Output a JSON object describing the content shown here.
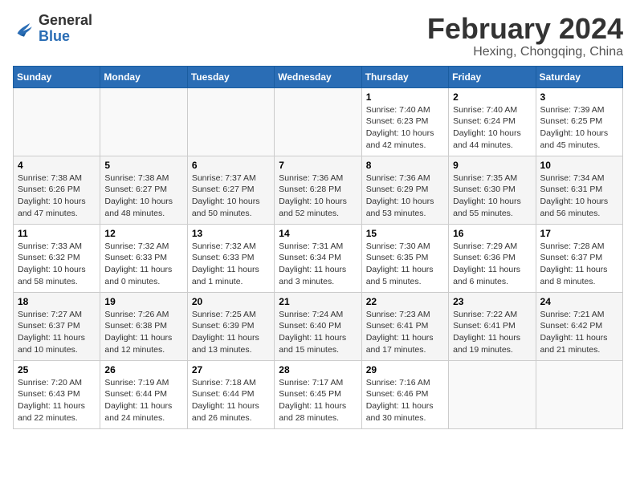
{
  "header": {
    "logo_general": "General",
    "logo_blue": "Blue",
    "month_year": "February 2024",
    "location": "Hexing, Chongqing, China"
  },
  "weekdays": [
    "Sunday",
    "Monday",
    "Tuesday",
    "Wednesday",
    "Thursday",
    "Friday",
    "Saturday"
  ],
  "weeks": [
    [
      {
        "day": "",
        "info": ""
      },
      {
        "day": "",
        "info": ""
      },
      {
        "day": "",
        "info": ""
      },
      {
        "day": "",
        "info": ""
      },
      {
        "day": "1",
        "info": "Sunrise: 7:40 AM\nSunset: 6:23 PM\nDaylight: 10 hours\nand 42 minutes."
      },
      {
        "day": "2",
        "info": "Sunrise: 7:40 AM\nSunset: 6:24 PM\nDaylight: 10 hours\nand 44 minutes."
      },
      {
        "day": "3",
        "info": "Sunrise: 7:39 AM\nSunset: 6:25 PM\nDaylight: 10 hours\nand 45 minutes."
      }
    ],
    [
      {
        "day": "4",
        "info": "Sunrise: 7:38 AM\nSunset: 6:26 PM\nDaylight: 10 hours\nand 47 minutes."
      },
      {
        "day": "5",
        "info": "Sunrise: 7:38 AM\nSunset: 6:27 PM\nDaylight: 10 hours\nand 48 minutes."
      },
      {
        "day": "6",
        "info": "Sunrise: 7:37 AM\nSunset: 6:27 PM\nDaylight: 10 hours\nand 50 minutes."
      },
      {
        "day": "7",
        "info": "Sunrise: 7:36 AM\nSunset: 6:28 PM\nDaylight: 10 hours\nand 52 minutes."
      },
      {
        "day": "8",
        "info": "Sunrise: 7:36 AM\nSunset: 6:29 PM\nDaylight: 10 hours\nand 53 minutes."
      },
      {
        "day": "9",
        "info": "Sunrise: 7:35 AM\nSunset: 6:30 PM\nDaylight: 10 hours\nand 55 minutes."
      },
      {
        "day": "10",
        "info": "Sunrise: 7:34 AM\nSunset: 6:31 PM\nDaylight: 10 hours\nand 56 minutes."
      }
    ],
    [
      {
        "day": "11",
        "info": "Sunrise: 7:33 AM\nSunset: 6:32 PM\nDaylight: 10 hours\nand 58 minutes."
      },
      {
        "day": "12",
        "info": "Sunrise: 7:32 AM\nSunset: 6:33 PM\nDaylight: 11 hours\nand 0 minutes."
      },
      {
        "day": "13",
        "info": "Sunrise: 7:32 AM\nSunset: 6:33 PM\nDaylight: 11 hours\nand 1 minute."
      },
      {
        "day": "14",
        "info": "Sunrise: 7:31 AM\nSunset: 6:34 PM\nDaylight: 11 hours\nand 3 minutes."
      },
      {
        "day": "15",
        "info": "Sunrise: 7:30 AM\nSunset: 6:35 PM\nDaylight: 11 hours\nand 5 minutes."
      },
      {
        "day": "16",
        "info": "Sunrise: 7:29 AM\nSunset: 6:36 PM\nDaylight: 11 hours\nand 6 minutes."
      },
      {
        "day": "17",
        "info": "Sunrise: 7:28 AM\nSunset: 6:37 PM\nDaylight: 11 hours\nand 8 minutes."
      }
    ],
    [
      {
        "day": "18",
        "info": "Sunrise: 7:27 AM\nSunset: 6:37 PM\nDaylight: 11 hours\nand 10 minutes."
      },
      {
        "day": "19",
        "info": "Sunrise: 7:26 AM\nSunset: 6:38 PM\nDaylight: 11 hours\nand 12 minutes."
      },
      {
        "day": "20",
        "info": "Sunrise: 7:25 AM\nSunset: 6:39 PM\nDaylight: 11 hours\nand 13 minutes."
      },
      {
        "day": "21",
        "info": "Sunrise: 7:24 AM\nSunset: 6:40 PM\nDaylight: 11 hours\nand 15 minutes."
      },
      {
        "day": "22",
        "info": "Sunrise: 7:23 AM\nSunset: 6:41 PM\nDaylight: 11 hours\nand 17 minutes."
      },
      {
        "day": "23",
        "info": "Sunrise: 7:22 AM\nSunset: 6:41 PM\nDaylight: 11 hours\nand 19 minutes."
      },
      {
        "day": "24",
        "info": "Sunrise: 7:21 AM\nSunset: 6:42 PM\nDaylight: 11 hours\nand 21 minutes."
      }
    ],
    [
      {
        "day": "25",
        "info": "Sunrise: 7:20 AM\nSunset: 6:43 PM\nDaylight: 11 hours\nand 22 minutes."
      },
      {
        "day": "26",
        "info": "Sunrise: 7:19 AM\nSunset: 6:44 PM\nDaylight: 11 hours\nand 24 minutes."
      },
      {
        "day": "27",
        "info": "Sunrise: 7:18 AM\nSunset: 6:44 PM\nDaylight: 11 hours\nand 26 minutes."
      },
      {
        "day": "28",
        "info": "Sunrise: 7:17 AM\nSunset: 6:45 PM\nDaylight: 11 hours\nand 28 minutes."
      },
      {
        "day": "29",
        "info": "Sunrise: 7:16 AM\nSunset: 6:46 PM\nDaylight: 11 hours\nand 30 minutes."
      },
      {
        "day": "",
        "info": ""
      },
      {
        "day": "",
        "info": ""
      }
    ]
  ]
}
